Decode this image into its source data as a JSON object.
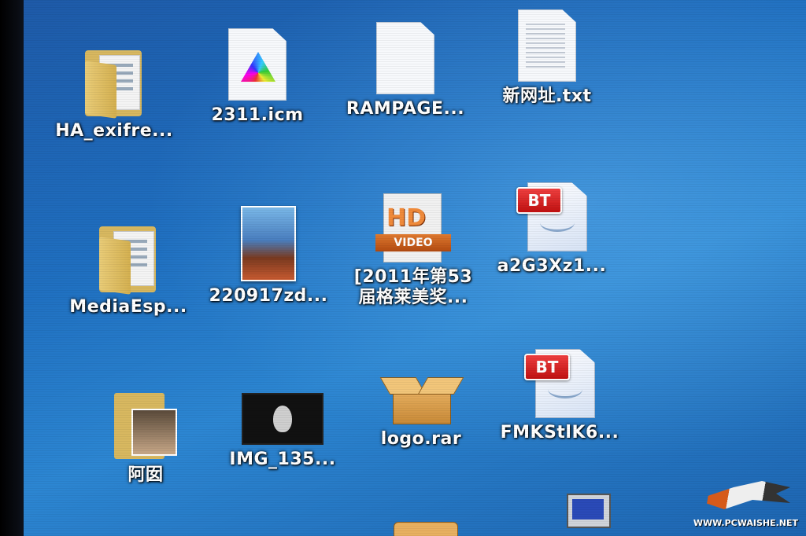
{
  "desktop": {
    "icons": [
      {
        "label": "HA_exifre..."
      },
      {
        "label": "2311.icm"
      },
      {
        "label": "RAMPAGE..."
      },
      {
        "label": "新网址.txt"
      },
      {
        "label": "MediaEsp..."
      },
      {
        "label": "220917zd..."
      },
      {
        "label": "[2011年第53\n届格莱美奖..."
      },
      {
        "label": "a2G3Xz1..."
      },
      {
        "label": "阿囡"
      },
      {
        "label": "IMG_135..."
      },
      {
        "label": "logo.rar"
      },
      {
        "label": "FMKStlK6..."
      }
    ],
    "hd_badge": "HD",
    "video_band": "VIDEO",
    "bt_badge": "BT"
  },
  "watermark": {
    "text": "WWW.PCWAISHE.NET"
  }
}
